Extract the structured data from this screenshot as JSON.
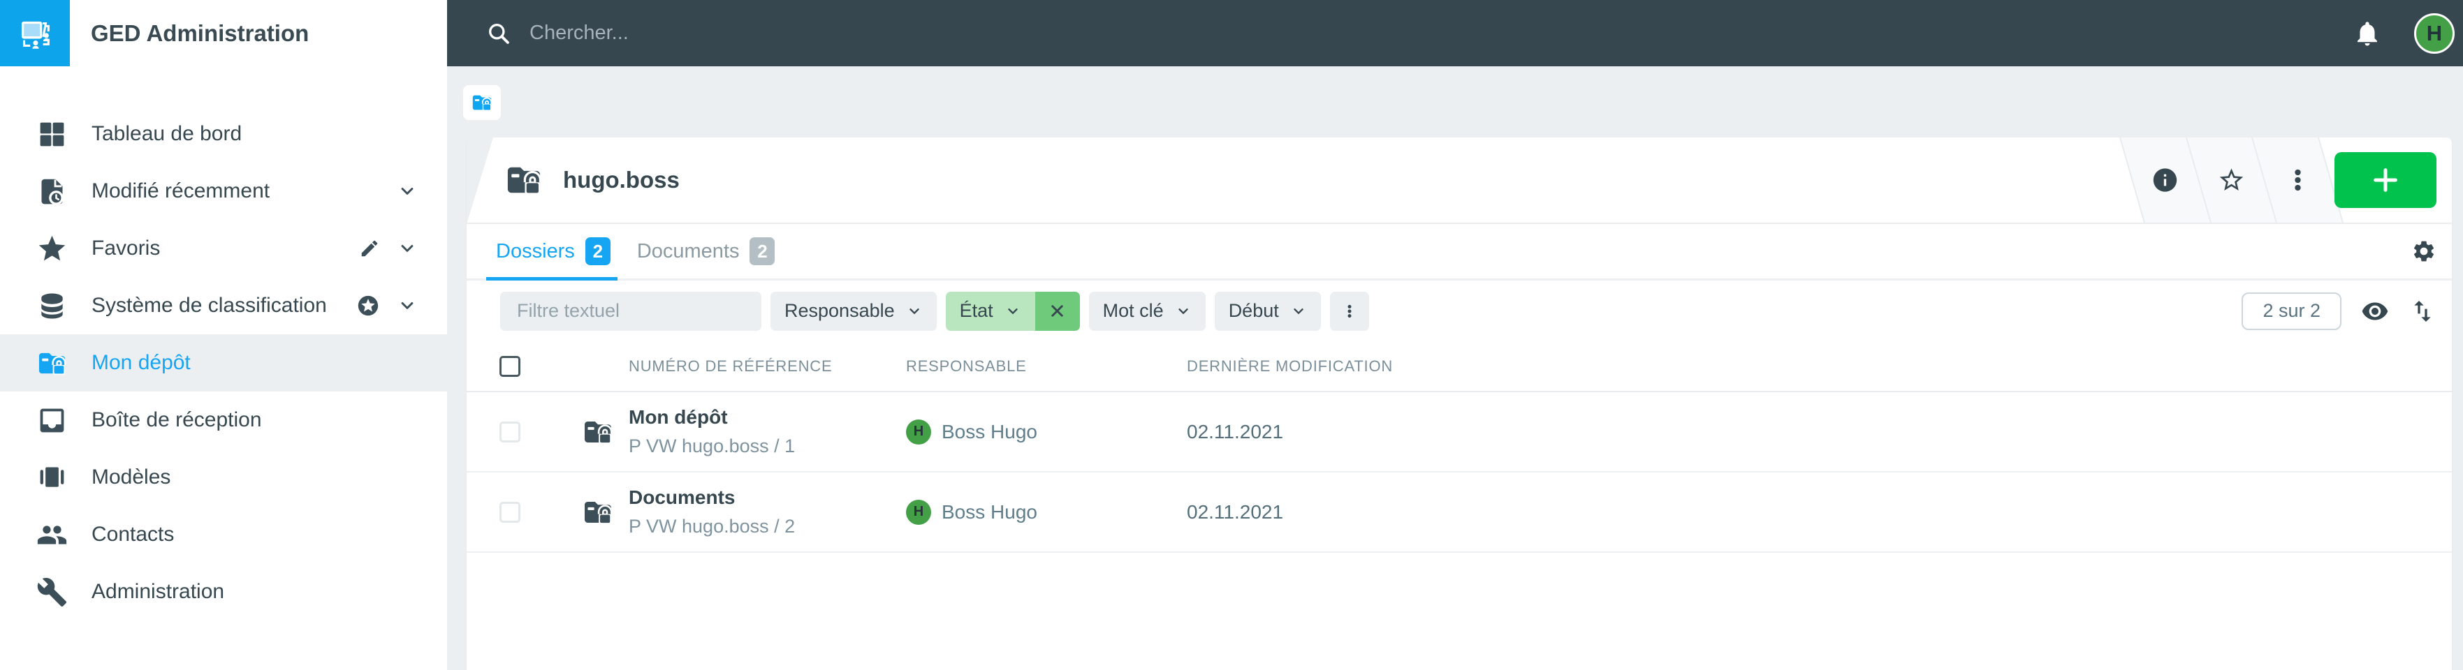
{
  "app": {
    "title": "GED Administration"
  },
  "topbar": {
    "search_placeholder": "Chercher...",
    "avatar_initial": "H",
    "icons": {
      "search": "magnifier",
      "notifications": "bell",
      "account": "avatar-circle"
    }
  },
  "sidebar": {
    "items": [
      {
        "label": "Tableau de bord",
        "icon": "dashboard-icon"
      },
      {
        "label": "Modifié récemment",
        "icon": "document-clock-icon",
        "chevron": true
      },
      {
        "label": "Favoris",
        "icon": "star-icon",
        "edit": true,
        "chevron": true
      },
      {
        "label": "Système de classification",
        "icon": "database-icon",
        "badge": "star-circle-icon",
        "chevron": true
      },
      {
        "label": "Mon dépôt",
        "icon": "folder-lock-icon",
        "active": true
      },
      {
        "label": "Boîte de réception",
        "icon": "inbox-icon"
      },
      {
        "label": "Modèles",
        "icon": "templates-icon"
      },
      {
        "label": "Contacts",
        "icon": "people-icon"
      },
      {
        "label": "Administration",
        "icon": "wrench-icon"
      }
    ]
  },
  "page": {
    "title": "hugo.boss",
    "title_icon": "folder-lock-icon",
    "breadcrumb_icon": "folder-lock-icon"
  },
  "header_actions": {
    "icons": [
      "info-icon",
      "star-outline-icon",
      "kebab-icon"
    ],
    "add_button": "plus-icon"
  },
  "tabs": [
    {
      "label": "Dossiers",
      "count": "2",
      "active": true
    },
    {
      "label": "Documents",
      "count": "2",
      "active": false
    }
  ],
  "filters": {
    "text_placeholder": "Filtre textuel",
    "responsable": "Responsable",
    "etat": "État",
    "mot_cle": "Mot clé",
    "debut": "Début",
    "result_count": "2 sur 2"
  },
  "table": {
    "columns": [
      "NUMÉRO DE RÉFÉRENCE",
      "RESPONSABLE",
      "DERNIÈRE MODIFICATION"
    ],
    "rows": [
      {
        "title": "Mon dépôt",
        "reference": "P VW hugo.boss / 1",
        "responsable": "Boss Hugo",
        "avatar_initial": "H",
        "modified": "02.11.2021"
      },
      {
        "title": "Documents",
        "reference": "P VW hugo.boss / 2",
        "responsable": "Boss Hugo",
        "avatar_initial": "H",
        "modified": "02.11.2021"
      }
    ]
  },
  "colors": {
    "topbar": "#37474f",
    "accent_blue": "#16a5f2",
    "logo_blue": "#0da4ec",
    "green_button": "#01c24d",
    "avatar_green": "#43a047",
    "chip_green_light": "#b9e6bf",
    "chip_green_dark": "#6fca7c",
    "background": "#eceff1"
  }
}
